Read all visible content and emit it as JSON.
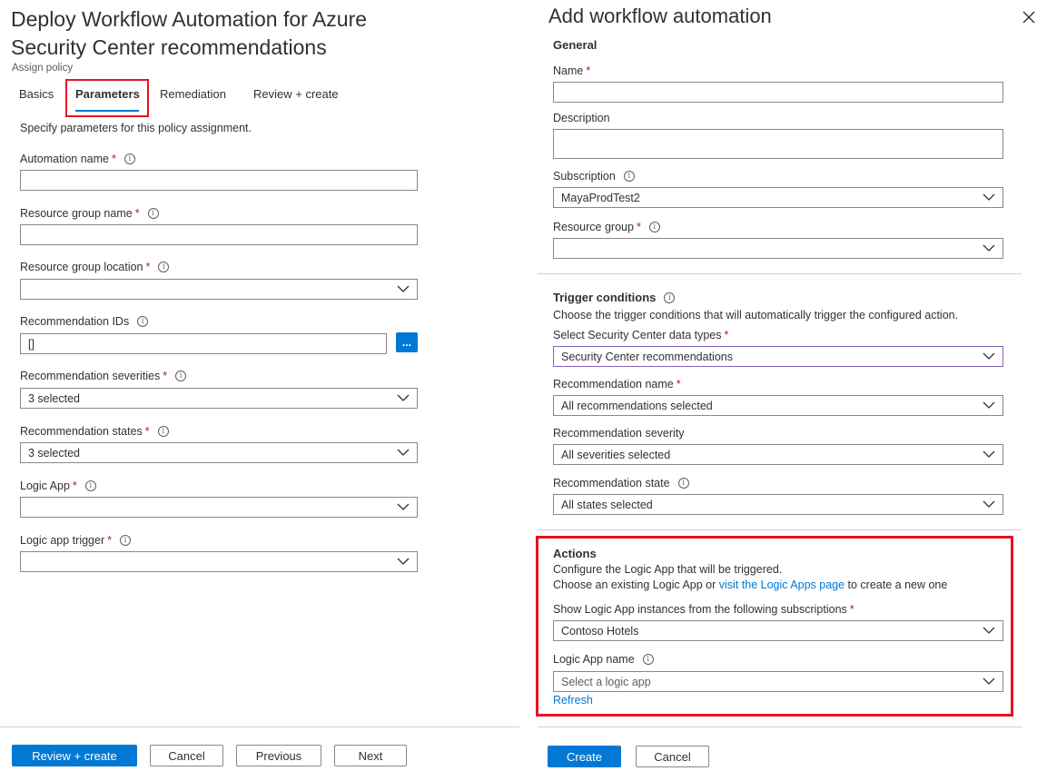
{
  "left": {
    "title": "Deploy Workflow Automation for Azure Security Center recommendations",
    "subtitle": "Assign policy",
    "tabs": [
      {
        "label": "Basics"
      },
      {
        "label": "Parameters"
      },
      {
        "label": "Remediation"
      },
      {
        "label": "Review + create"
      }
    ],
    "description": "Specify parameters for this policy assignment.",
    "fields": {
      "automation_name": {
        "label": "Automation name",
        "value": ""
      },
      "resource_group_name": {
        "label": "Resource group name",
        "value": ""
      },
      "resource_group_location": {
        "label": "Resource group location",
        "value": ""
      },
      "recommendation_ids": {
        "label": "Recommendation IDs",
        "value": "[]",
        "button": "..."
      },
      "recommendation_severities": {
        "label": "Recommendation severities",
        "value": "3 selected"
      },
      "recommendation_states": {
        "label": "Recommendation states",
        "value": "3 selected"
      },
      "logic_app": {
        "label": "Logic App",
        "value": ""
      },
      "logic_app_trigger": {
        "label": "Logic app trigger",
        "value": ""
      }
    },
    "footer": {
      "review_create": "Review + create",
      "cancel": "Cancel",
      "previous": "Previous",
      "next": "Next"
    }
  },
  "right": {
    "title": "Add workflow automation",
    "general": {
      "heading": "General",
      "name_label": "Name",
      "name_value": "",
      "description_label": "Description",
      "description_value": "",
      "subscription_label": "Subscription",
      "subscription_value": "MayaProdTest2",
      "resource_group_label": "Resource group",
      "resource_group_value": ""
    },
    "trigger": {
      "heading": "Trigger conditions",
      "description": "Choose the trigger conditions that will automatically trigger the configured action.",
      "data_types_label": "Select Security Center data types",
      "data_types_value": "Security Center recommendations",
      "rec_name_label": "Recommendation name",
      "rec_name_value": "All recommendations selected",
      "rec_severity_label": "Recommendation severity",
      "rec_severity_value": "All severities selected",
      "rec_state_label": "Recommendation state",
      "rec_state_value": "All states selected"
    },
    "actions": {
      "heading": "Actions",
      "line1": "Configure the Logic App that will be triggered.",
      "line2_pre": "Choose an existing Logic App or ",
      "line2_link": "visit the Logic Apps page",
      "line2_post": " to create a new one",
      "subs_label": "Show Logic App instances from the following subscriptions",
      "subs_value": "Contoso Hotels",
      "logic_app_name_label": "Logic App name",
      "logic_app_name_placeholder": "Select a logic app",
      "refresh": "Refresh"
    },
    "footer": {
      "create": "Create",
      "cancel": "Cancel"
    }
  },
  "colors": {
    "accent": "#0078d4",
    "highlight": "#e81123",
    "required": "#a4262c"
  }
}
